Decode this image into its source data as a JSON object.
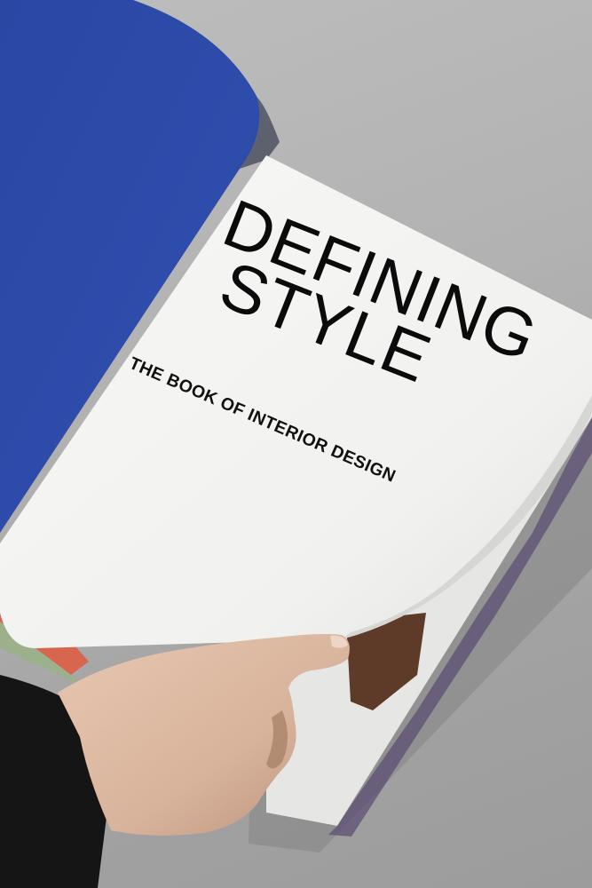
{
  "book": {
    "title_line_1": "DEFINING",
    "title_line_2": "STYLE",
    "subtitle": "THE BOOK OF INTERIOR DESIGN"
  },
  "colors": {
    "cover_blue": "#2e4aa3",
    "page_white": "#f4f4f2",
    "background_gray": "#b4b4b4",
    "sleeve_black": "#141414",
    "skin": "#dcb7a0"
  }
}
